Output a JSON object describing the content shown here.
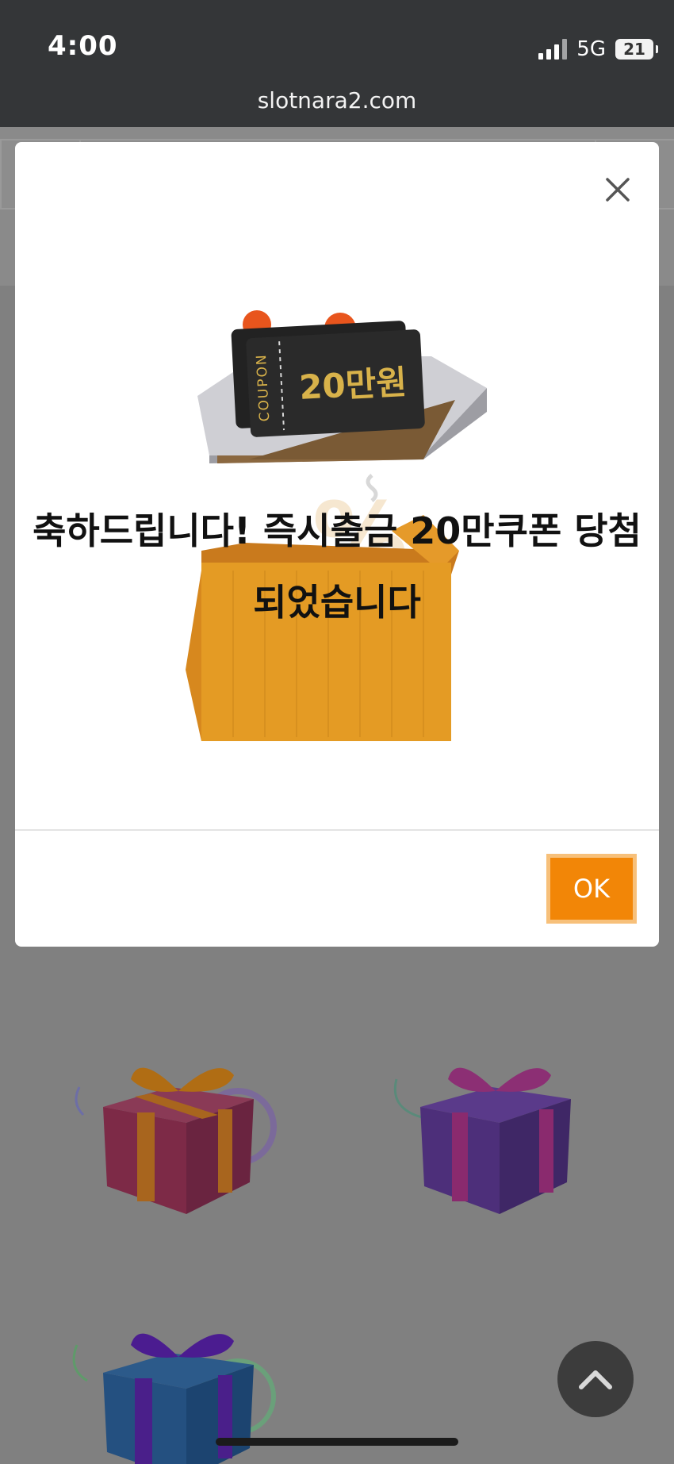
{
  "status_bar": {
    "time": "4:00",
    "network": "5G",
    "battery": "21"
  },
  "browser": {
    "url": "slotnara2.com"
  },
  "modal": {
    "coupon_label": "COUPON",
    "coupon_amount": "20만원",
    "message_line1": "축하드립니다! 즉시출금 20만쿠폰 당첨",
    "message_line2": "되었습니다",
    "ok_label": "OK"
  },
  "colors": {
    "accent": "#f28607",
    "overlay": "#808080"
  }
}
